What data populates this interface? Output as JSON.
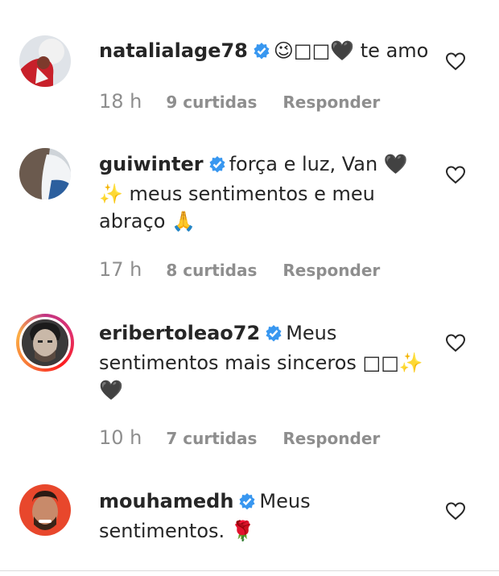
{
  "comments": [
    {
      "username": "natalialage78",
      "text": "😉□□🖤 te amo",
      "time": "18 h",
      "likes": "9 curtidas",
      "reply": "Responder"
    },
    {
      "username": "guiwinter",
      "text": "força e luz, Van 🖤✨ meus sentimentos e meu abraço 🙏",
      "time": "17 h",
      "likes": "8 curtidas",
      "reply": "Responder"
    },
    {
      "username": "eribertoleao72",
      "text": "Meus sentimentos mais sinceros □□✨ 🖤",
      "time": "10 h",
      "likes": "7 curtidas",
      "reply": "Responder"
    },
    {
      "username": "mouhamedh",
      "text": "Meus sentimentos. 🌹",
      "time": "",
      "likes": "",
      "reply": ""
    }
  ],
  "icons": {
    "verified": "verified-badge-icon",
    "like": "heart-outline-icon"
  },
  "colors": {
    "verified": "#3897f0",
    "meta": "#8e8e8e",
    "text": "#262626"
  }
}
